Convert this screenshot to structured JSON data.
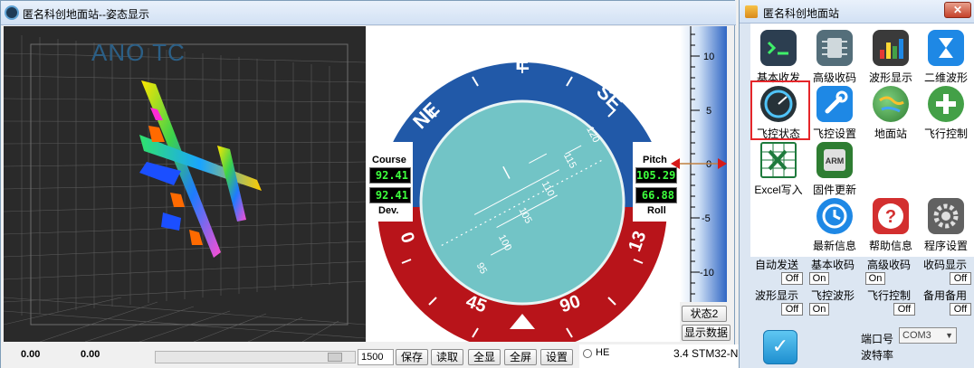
{
  "main_window": {
    "title": "匿名科创地面站--姿态显示",
    "viewport_label": "ANO TC",
    "heading_labels": {
      "e": "E",
      "ne": "NE",
      "se": "SE"
    },
    "roll_labels": [
      "0",
      "45",
      "90",
      "13"
    ],
    "pitch_ticks": [
      "95",
      "100",
      "105",
      "110",
      "115",
      "120"
    ],
    "readouts": {
      "course_label": "Course",
      "course_value": "92.41",
      "dev_value": "92.41",
      "dev_label": "Dev.",
      "pitch_label": "Pitch",
      "pitch_value": "105.29",
      "roll_value": "66.88",
      "roll_label": "Roll"
    },
    "scale_ticks": [
      "10",
      "5",
      "0",
      "-5",
      "-10"
    ],
    "status_button": "状态2",
    "show_data_button": "显示数据",
    "bottom_bar": {
      "coord_x": "0.00",
      "coord_y": "0.00",
      "rate_value": "1500",
      "buttons": [
        "保存",
        "读取",
        "全显",
        "全屏",
        "设置"
      ]
    }
  },
  "background_window": {
    "radio_label": "HE",
    "list_item": "3.4  STM32-N"
  },
  "panel": {
    "title": "匿名科创地面站",
    "close_label": "✕",
    "tools": [
      {
        "label": "基本收发",
        "icon": "terminal-icon",
        "color": "#2c3e50"
      },
      {
        "label": "高级收码",
        "icon": "chip-icon",
        "color": "#546e7a"
      },
      {
        "label": "波形显示",
        "icon": "bar-chart-icon",
        "color": "#3a3a3a"
      },
      {
        "label": "二维波形",
        "icon": "hourglass-icon",
        "color": "#1e88e5"
      },
      {
        "label": "飞控状态",
        "icon": "gauge-icon",
        "color": "#263238"
      },
      {
        "label": "飞控设置",
        "icon": "wrench-icon",
        "color": "#1e88e5"
      },
      {
        "label": "地面站",
        "icon": "globe-icon",
        "color": "#43a047"
      },
      {
        "label": "飞行控制",
        "icon": "plus-icon",
        "color": "#43a047"
      },
      {
        "label": "Excel写入",
        "icon": "excel-icon",
        "color": "#1e7a3c"
      },
      {
        "label": "固件更新",
        "icon": "arm-chip-icon",
        "color": "#2e7d32"
      },
      {
        "label": "最新信息",
        "icon": "clock-icon",
        "color": "#1e88e5"
      },
      {
        "label": "帮助信息",
        "icon": "help-icon",
        "color": "#d32f2f"
      },
      {
        "label": "程序设置",
        "icon": "settings-gear-icon",
        "color": "#616161"
      }
    ],
    "toggles": [
      {
        "label": "自动发送",
        "state": "Off"
      },
      {
        "label": "基本收码",
        "state": "On"
      },
      {
        "label": "高级收码",
        "state": "On"
      },
      {
        "label": "收码显示",
        "state": "Off"
      },
      {
        "label": "波形显示",
        "state": "Off"
      },
      {
        "label": "飞控波形",
        "state": "On"
      },
      {
        "label": "飞行控制",
        "state": "Off"
      },
      {
        "label": "备用备用",
        "state": "Off"
      }
    ],
    "port_label": "端口号",
    "baud_label": "波特率",
    "port_value": "COM3"
  },
  "colors": {
    "heading_blue": "#2159a8",
    "roll_red": "#b8141a",
    "ball_teal": "#72c4c6",
    "readout_green": "#3dff3d",
    "highlight_red": "#e5262a",
    "pointer_red": "#d61a1a"
  }
}
